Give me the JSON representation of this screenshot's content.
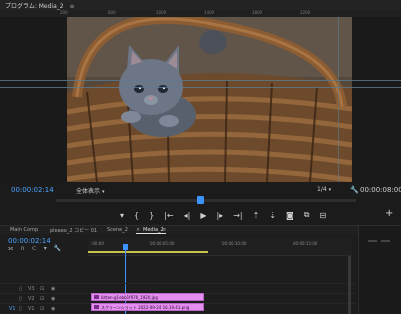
{
  "monitor": {
    "title": "プログラム: Media_2",
    "menu_icon": "hamburger-icon",
    "ruler_labels": [
      "200",
      "600",
      "1000",
      "1400",
      "1800",
      "2200"
    ],
    "timecode_current": "00:00:02:14",
    "fit_value": "全体表示",
    "quality_value": "1/4",
    "timecode_duration": "00:00:08:00"
  },
  "transport": {
    "buttons": [
      {
        "name": "add-marker-button",
        "glyph": "▾"
      },
      {
        "name": "mark-in-button",
        "glyph": "{"
      },
      {
        "name": "mark-out-button",
        "glyph": "}"
      },
      {
        "name": "go-to-in-button",
        "glyph": "|←"
      },
      {
        "name": "step-back-button",
        "glyph": "◂|"
      },
      {
        "name": "play-button",
        "glyph": "▶"
      },
      {
        "name": "step-forward-button",
        "glyph": "|▸"
      },
      {
        "name": "go-to-out-button",
        "glyph": "→|"
      },
      {
        "name": "lift-button",
        "glyph": "⇡"
      },
      {
        "name": "extract-button",
        "glyph": "⇣"
      },
      {
        "name": "export-frame-button",
        "glyph": "◙"
      },
      {
        "name": "comparison-view-button",
        "glyph": "⧉"
      },
      {
        "name": "proxy-toggle-button",
        "glyph": "⊟"
      }
    ],
    "add_button": "+"
  },
  "timeline": {
    "tabs": [
      "Main Comp",
      "pleaeo_2 コピー 01",
      "Scene_2",
      "Media_2"
    ],
    "active_tab": "Media_2",
    "timecode": "00:00:02:14",
    "ruler_labels": [
      ":00:00",
      "00:00:05:00",
      "00:00:10:00",
      "00:00:15:00"
    ],
    "tracks": [
      {
        "id": "V3",
        "label": "V3"
      },
      {
        "id": "V2",
        "label": "V2"
      },
      {
        "id": "V1",
        "label": "V1"
      }
    ],
    "clips": [
      {
        "name": "kitten-g1ebb1f976_1920.jpg"
      },
      {
        "name": "スクリーンショット 2022-09-24 16.19.41.png"
      }
    ]
  },
  "colors": {
    "accent_blue": "#4aa3ff",
    "clip_pink": "#e48ef0",
    "work_area_yellow": "#c9c34a"
  }
}
